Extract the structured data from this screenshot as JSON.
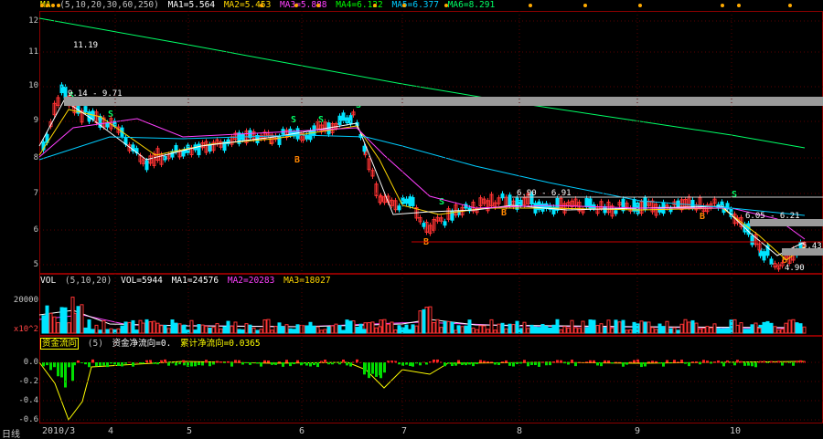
{
  "price_panel": {
    "indicator_label": "MA",
    "params": "(5,10,20,30,60,250)",
    "ma": [
      {
        "label": "MA1=5.564",
        "color": "#ffffff"
      },
      {
        "label": "MA2=5.453",
        "color": "#ffd700"
      },
      {
        "label": "MA3=5.888",
        "color": "#ff40ff"
      },
      {
        "label": "MA4=6.122",
        "color": "#00ff00"
      },
      {
        "label": "MA5=6.377",
        "color": "#00ccff"
      },
      {
        "label": "MA6=8.291",
        "color": "#00ff66"
      }
    ],
    "y_ticks": [
      "12",
      "11",
      "10",
      "9",
      "8",
      "7",
      "6",
      "5"
    ],
    "annotations": {
      "high": "11.19",
      "range1": "9.14 - 9.71",
      "range2": "6.90 - 6.91",
      "range3": "6.05 - 6.21",
      "right_price": "5.43",
      "low": "4.90"
    },
    "signals": {
      "buy": "B",
      "sell": "S"
    }
  },
  "volume_panel": {
    "indicator_label": "VOL",
    "params": "(5,10,20)",
    "vol": "VOL=5944",
    "ma": [
      {
        "label": "MA1=24576",
        "color": "#ffffff"
      },
      {
        "label": "MA2=20283",
        "color": "#ff40ff"
      },
      {
        "label": "MA3=18027",
        "color": "#ffd700"
      }
    ],
    "y_ticks": [
      "20000",
      "x10^2"
    ]
  },
  "flow_panel": {
    "indicator_label": "资金流向",
    "params": "(5)",
    "line1": "资金净流向=0.",
    "line2": "累计净流向=0.0365",
    "y_ticks": [
      "0.0",
      "-0.2",
      "-0.4",
      "-0.6"
    ]
  },
  "x_axis": {
    "period": "日线",
    "ticks": [
      "2010/3",
      "4",
      "5",
      "6",
      "7",
      "8",
      "9",
      "10"
    ]
  },
  "colors": {
    "up": "#ff3333",
    "down": "#00e5ff",
    "frame": "#8b0000",
    "grid": "#5a0000"
  }
}
